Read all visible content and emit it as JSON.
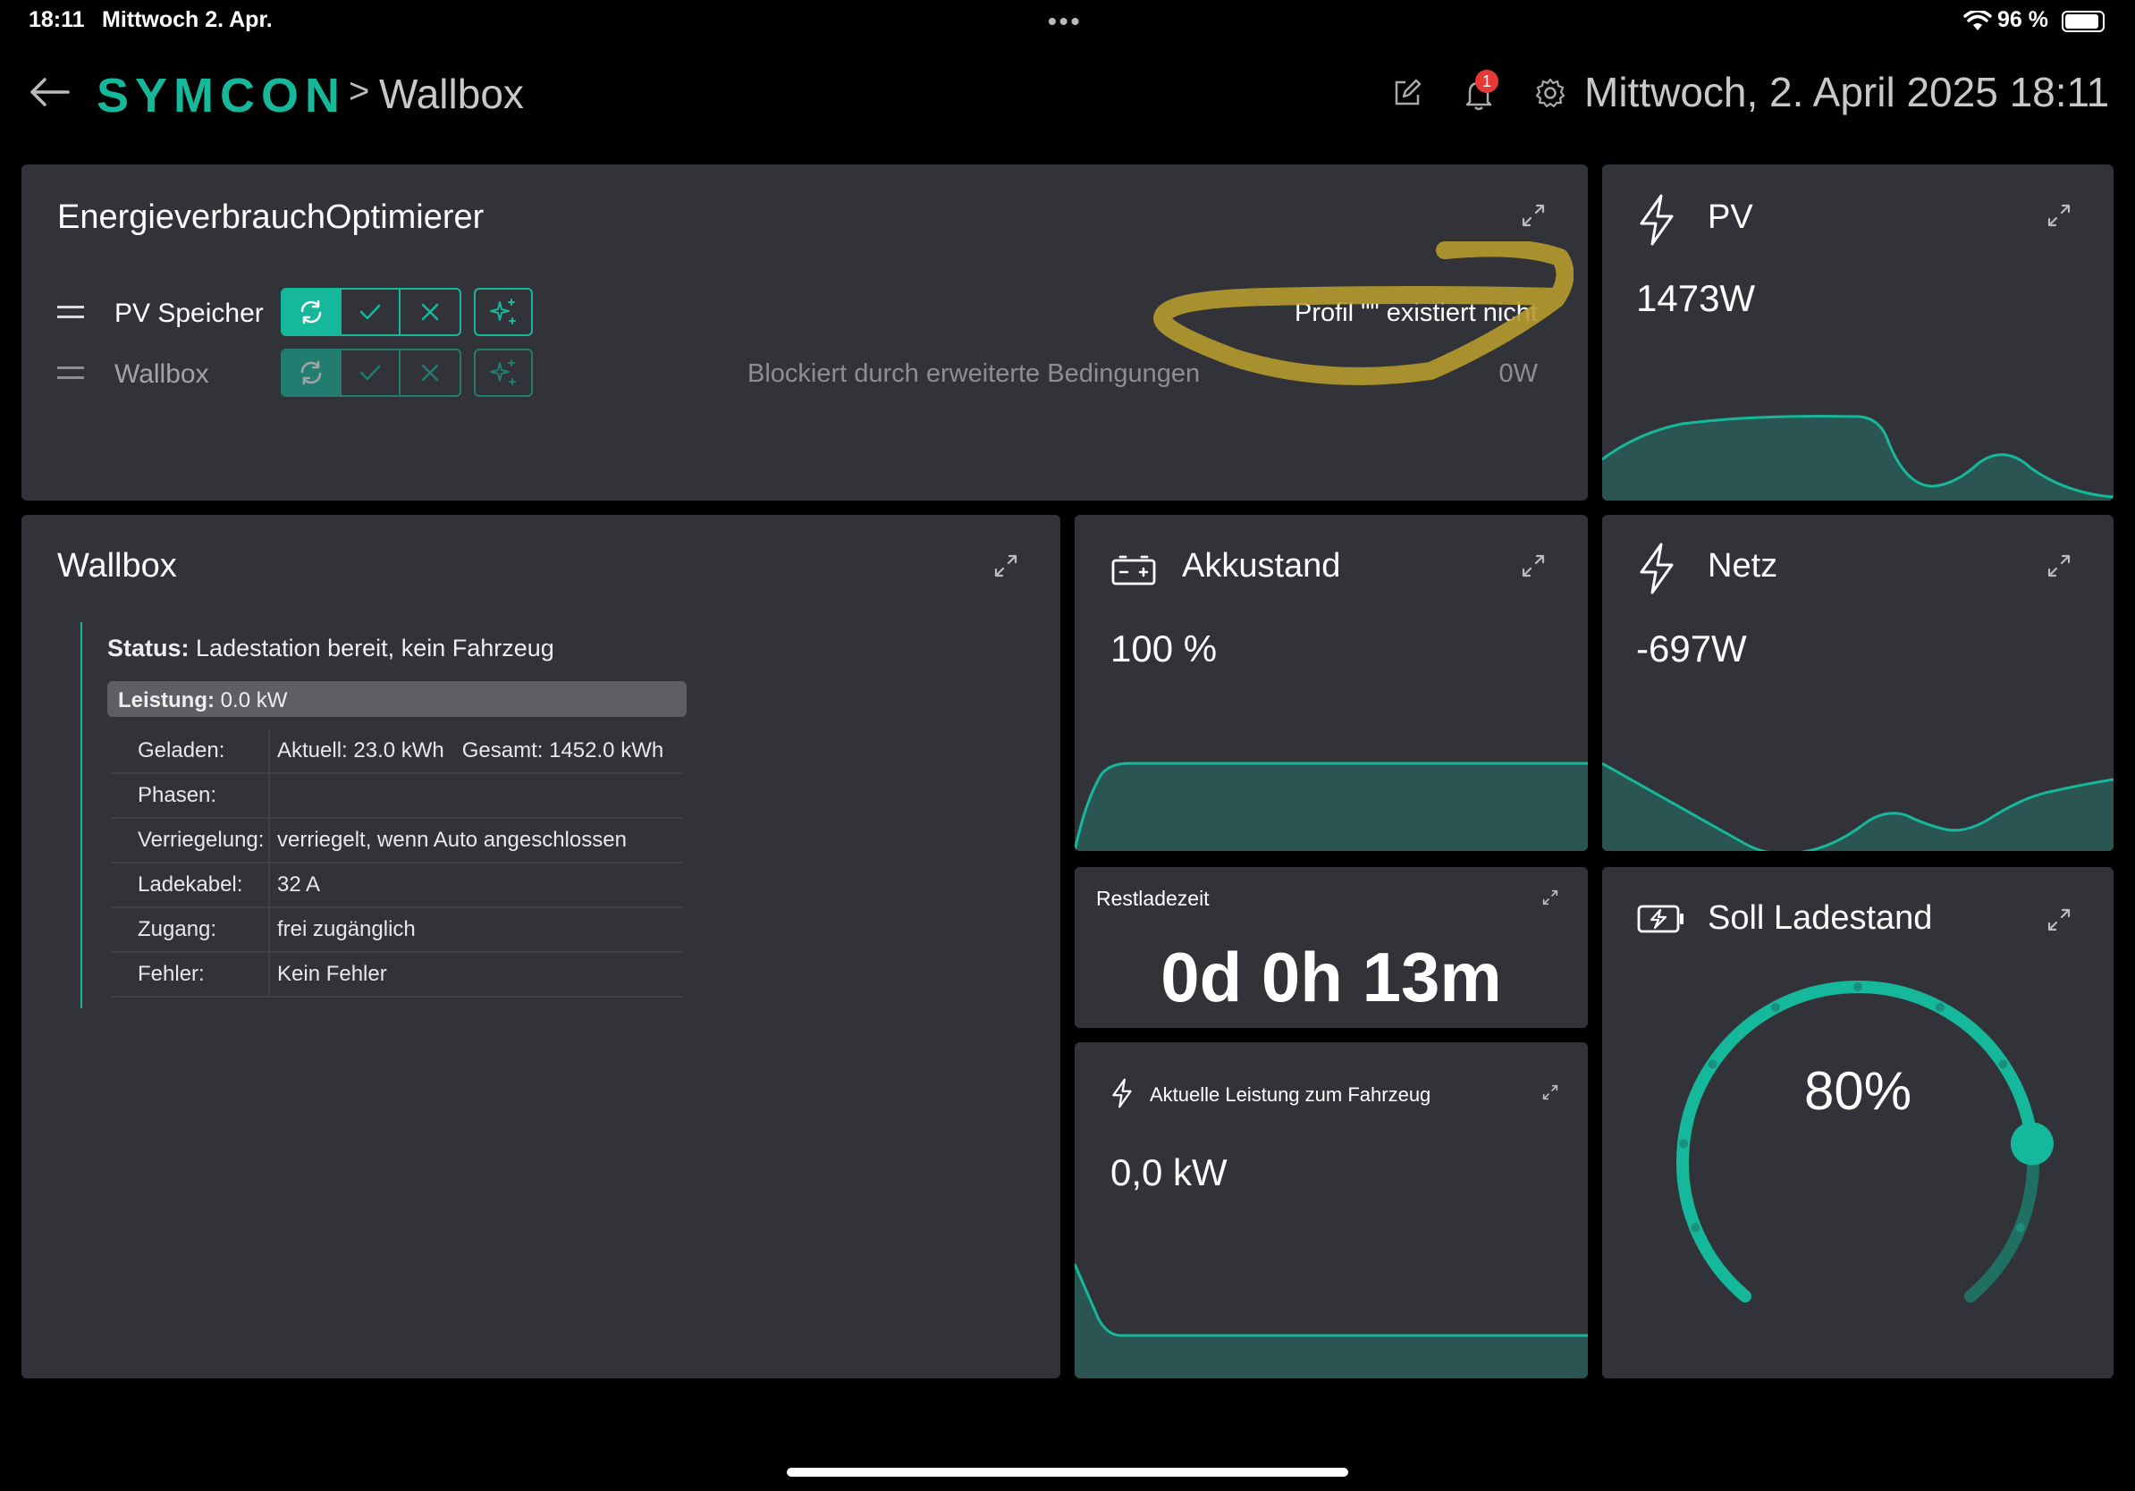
{
  "status_bar": {
    "time": "18:11",
    "date": "Mittwoch 2. Apr.",
    "battery": "96 %"
  },
  "header": {
    "brand": "SYMCON",
    "breadcrumb_separator": ">",
    "breadcrumb_current": "Wallbox",
    "datetime": "Mittwoch, 2. April 2025 18:11",
    "notification_count": "1"
  },
  "optimizer": {
    "title": "EnergieverbrauchOptimierer",
    "rows": [
      {
        "label": "PV Speicher",
        "status": "Profil \"\" existiert nicht",
        "value": ""
      },
      {
        "label": "Wallbox",
        "status": "Blockiert durch erweiterte Bedingungen",
        "value": "0W"
      }
    ]
  },
  "pv": {
    "title": "PV",
    "value": "1473W"
  },
  "wallbox": {
    "title": "Wallbox",
    "status_label": "Status:",
    "status_value": "Ladestation bereit, kein Fahrzeug",
    "power_label": "Leistung:",
    "power_value": "0.0 kW",
    "rows": [
      {
        "key": "Geladen:",
        "value": "Aktuell: 23.0 kWh   Gesamt: 1452.0 kWh"
      },
      {
        "key": "Phasen:",
        "value": ""
      },
      {
        "key": "Verriegelung:",
        "value": "verriegelt, wenn Auto angeschlossen"
      },
      {
        "key": "Ladekabel:",
        "value": "32 A"
      },
      {
        "key": "Zugang:",
        "value": "frei zugänglich"
      },
      {
        "key": "Fehler:",
        "value": "Kein Fehler"
      }
    ]
  },
  "akku": {
    "title": "Akkustand",
    "value": "100 %"
  },
  "netz": {
    "title": "Netz",
    "value": "-697W"
  },
  "restlade": {
    "title": "Restladezeit",
    "value": "0d 0h 13m"
  },
  "leistung": {
    "title": "Aktuelle Leistung zum Fahrzeug",
    "value": "0,0 kW"
  },
  "soll": {
    "title": "Soll Ladestand",
    "value": "80%",
    "level_percent": 80
  },
  "colors": {
    "accent": "#16b89c",
    "card": "#323338",
    "area": "#2b5552",
    "notification": "#e53935"
  }
}
